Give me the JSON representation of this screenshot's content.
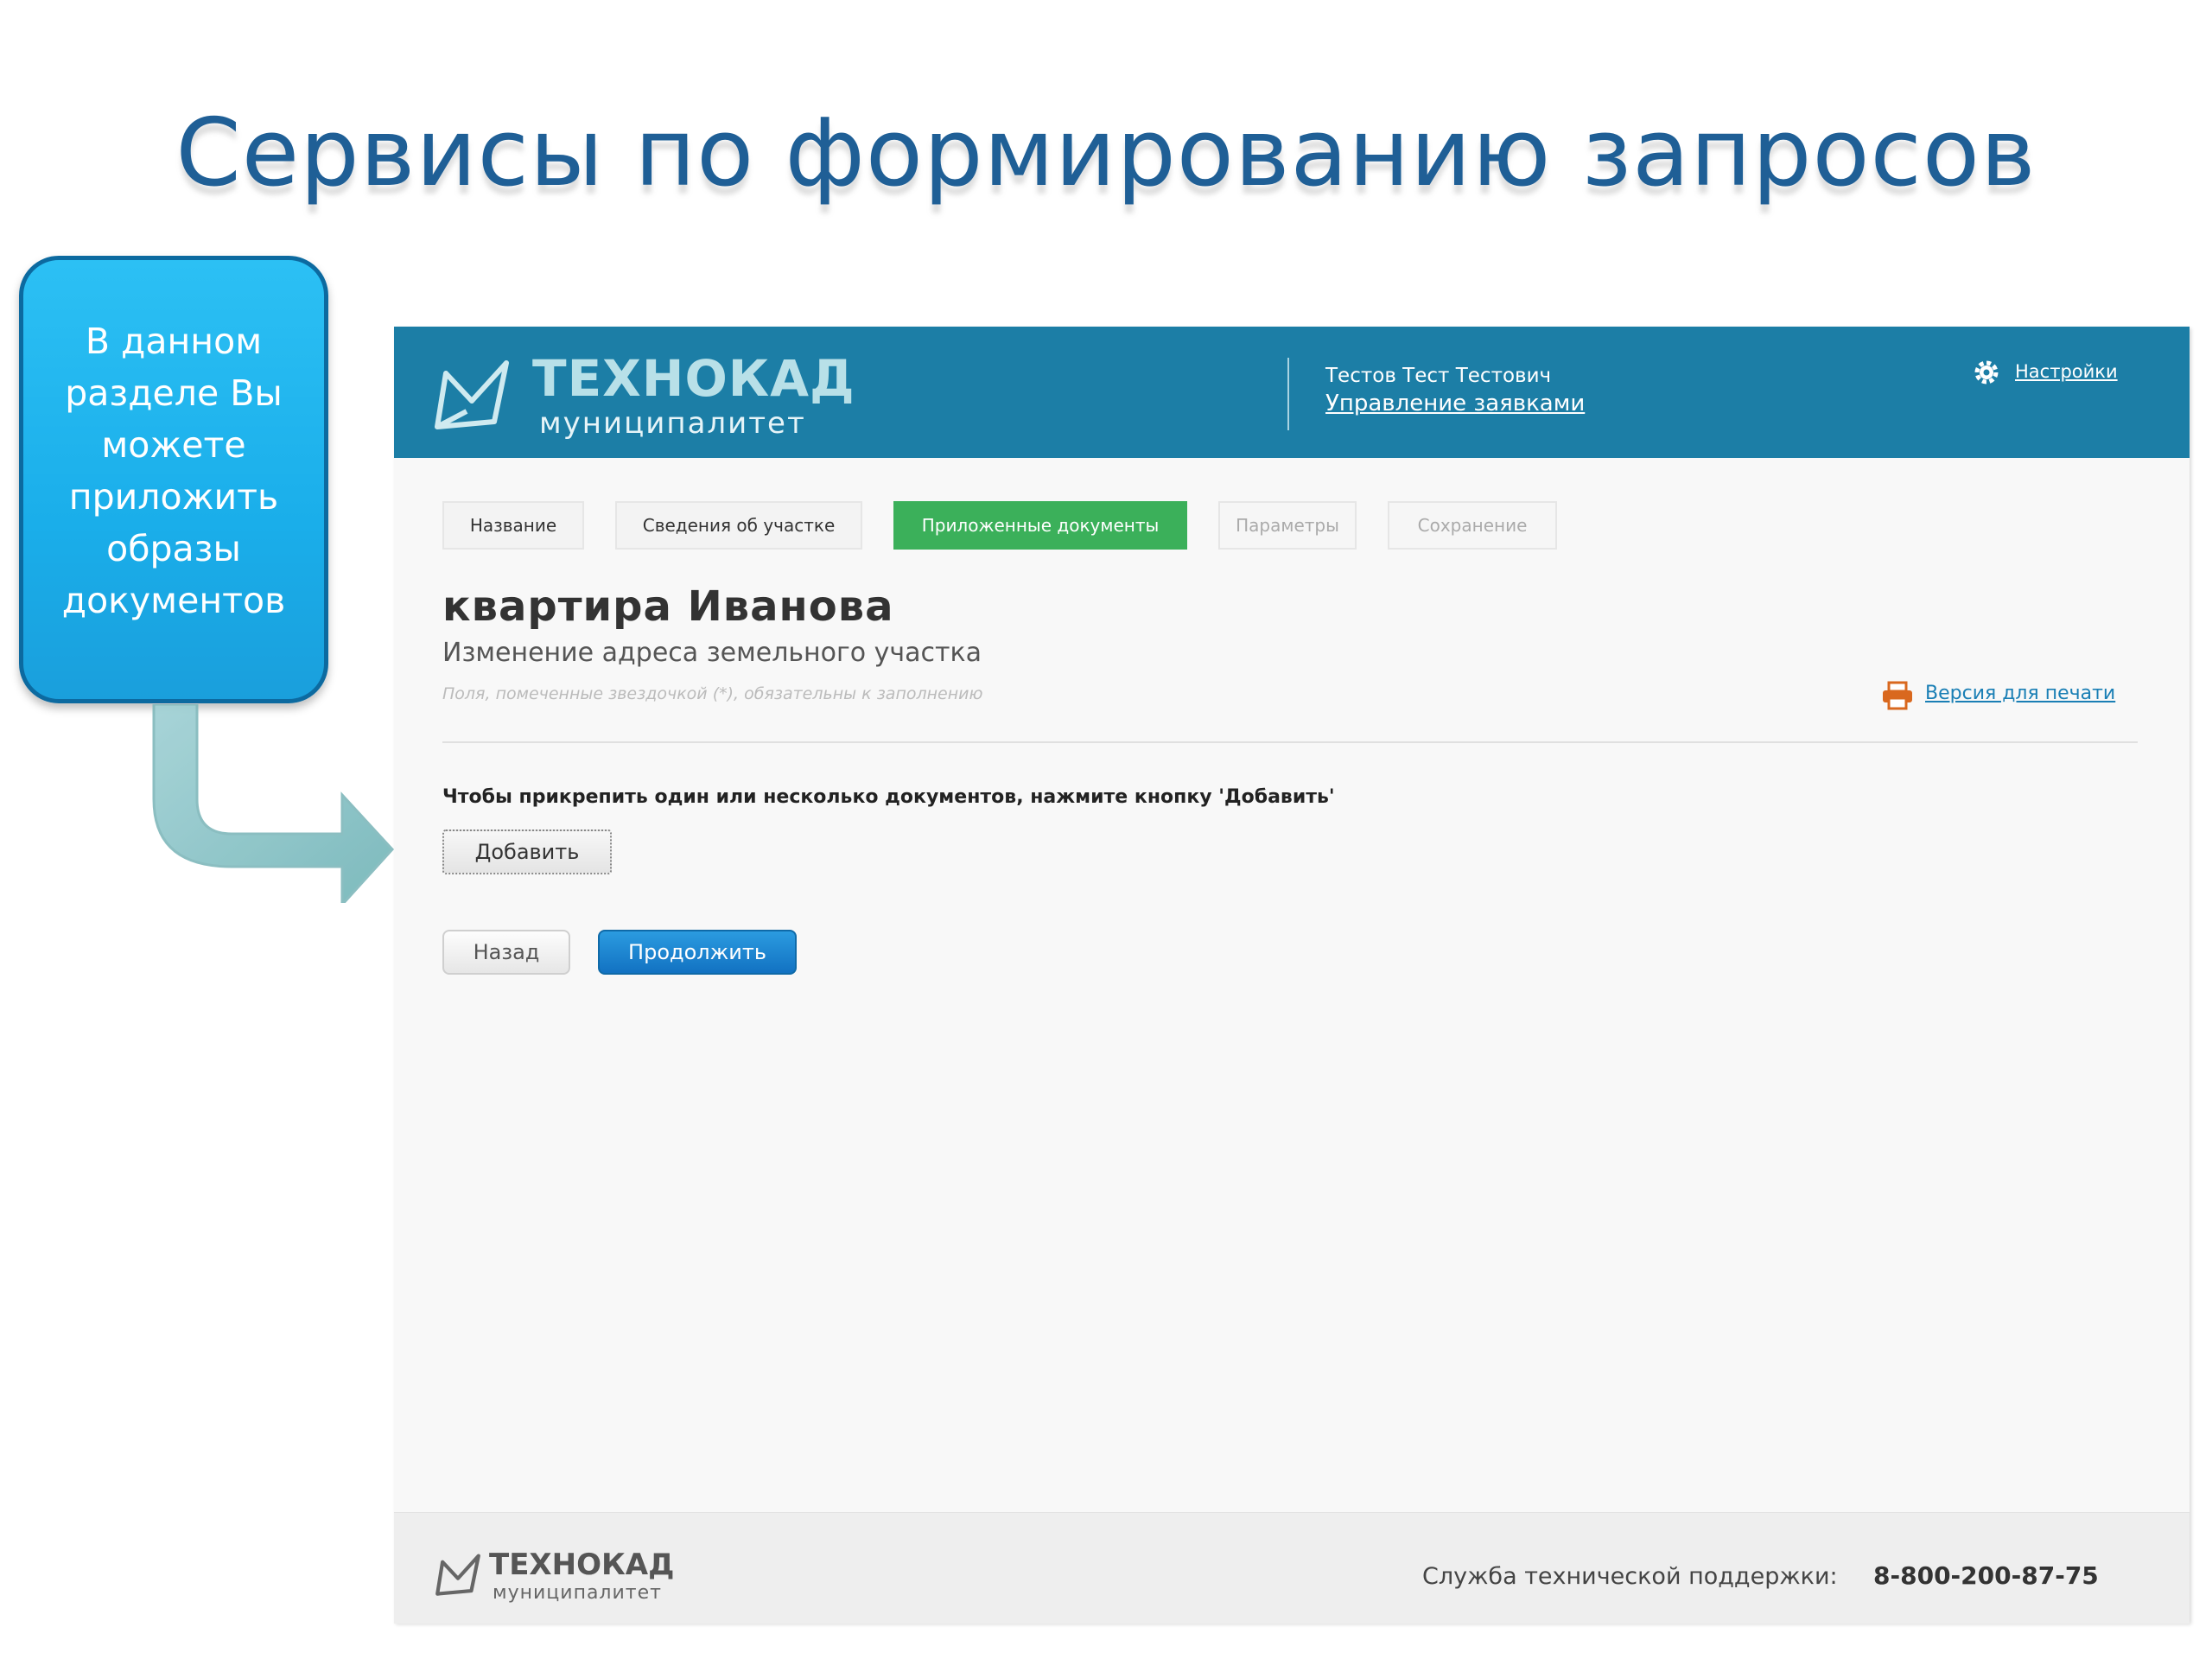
{
  "slide": {
    "title": "Сервисы по формированию запросов",
    "callout_text": "В данном разделе Вы можете приложить образы документов"
  },
  "header": {
    "brand": "ТЕХНОКАД",
    "brand_sub": "муниципалитет",
    "user_name": "Тестов Тест Тестович",
    "manage_link": "Управление заявками",
    "settings_label": "Настройки"
  },
  "tabs": [
    {
      "label": "Название",
      "state": "normal"
    },
    {
      "label": "Сведения об участке",
      "state": "normal"
    },
    {
      "label": "Приложенные документы",
      "state": "active"
    },
    {
      "label": "Параметры",
      "state": "disabled"
    },
    {
      "label": "Сохранение",
      "state": "disabled"
    }
  ],
  "main": {
    "heading": "квартира Иванова",
    "subtitle": "Изменение адреса земельного участка",
    "required_note": "Поля, помеченные звездочкой (*), обязательны к заполнению",
    "print_link": "Версия для печати",
    "instruction": "Чтобы прикрепить один или несколько документов, нажмите кнопку 'Добавить'",
    "add_button": "Добавить",
    "back_button": "Назад",
    "continue_button": "Продолжить"
  },
  "footer": {
    "brand": "ТЕХНОКАД",
    "brand_sub": "муниципалитет",
    "support_label": "Служба технической поддержки:",
    "support_phone": "8-800-200-87-75"
  },
  "colors": {
    "header_bg": "#1c7ea6",
    "active_tab": "#3bb05a",
    "primary_button": "#1a7fc8",
    "title": "#1f5f96",
    "callout": "#22b6ef"
  },
  "icons": [
    "logo-mark-icon",
    "gear-icon",
    "printer-icon",
    "arrow-icon"
  ]
}
